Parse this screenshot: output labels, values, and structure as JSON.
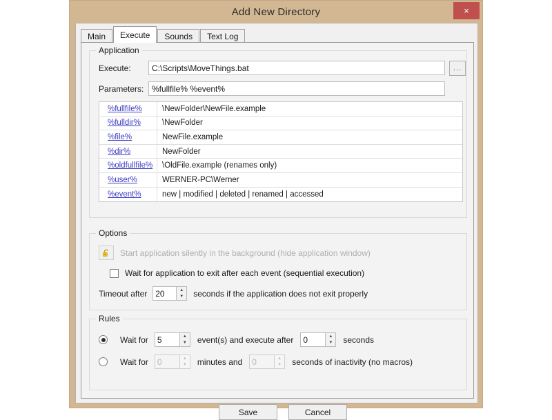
{
  "window": {
    "title": "Add New Directory",
    "close_label": "×"
  },
  "tabs": [
    {
      "label": "Main",
      "active": false
    },
    {
      "label": "Execute",
      "active": true
    },
    {
      "label": "Sounds",
      "active": false
    },
    {
      "label": "Text Log",
      "active": false
    }
  ],
  "application": {
    "group_title": "Application",
    "execute_label": "Execute:",
    "execute_value": "C:\\Scripts\\MoveThings.bat",
    "execute_placeholder": "",
    "browse_label": "...",
    "parameters_label": "Parameters:",
    "parameters_value": "%fullfile% %event%",
    "parameters_placeholder": "",
    "variables": [
      {
        "key": "%fullfile%",
        "value": "\\NewFolder\\NewFile.example"
      },
      {
        "key": "%fulldir%",
        "value": "\\NewFolder"
      },
      {
        "key": "%file%",
        "value": "NewFile.example"
      },
      {
        "key": "%dir%",
        "value": "NewFolder"
      },
      {
        "key": "%oldfullfile%",
        "value": "\\OldFile.example (renames only)"
      },
      {
        "key": "%user%",
        "value": "WERNER-PC\\Werner"
      },
      {
        "key": "%event%",
        "value": "new | modified | deleted | renamed | accessed"
      }
    ]
  },
  "options": {
    "group_title": "Options",
    "silent_label": "Start application silently in the background (hide application window)",
    "silent_icon": "unlocked-padlock-icon",
    "wait_exit_label": "Wait for application to exit after each event (sequential execution)",
    "wait_exit_checked": false,
    "timeout_prefix": "Timeout after",
    "timeout_value": "20",
    "timeout_suffix": "seconds if the application does not exit properly"
  },
  "rules": {
    "group_title": "Rules",
    "rule1_selected": true,
    "rule1_prefix": "Wait for",
    "rule1_events_value": "5",
    "rule1_middle": "event(s) and execute after",
    "rule1_seconds_value": "0",
    "rule1_suffix": "seconds",
    "rule2_selected": false,
    "rule2_prefix": "Wait for",
    "rule2_minutes_value": "0",
    "rule2_middle": "minutes and",
    "rule2_seconds_value": "0",
    "rule2_suffix": "seconds of inactivity (no macros)"
  },
  "footer": {
    "save_label": "Save",
    "cancel_label": "Cancel"
  },
  "colors": {
    "window_frame": "#d3b793",
    "close_button": "#c0504d",
    "link": "#3b3bc4",
    "padlock": "#f2c21c"
  }
}
